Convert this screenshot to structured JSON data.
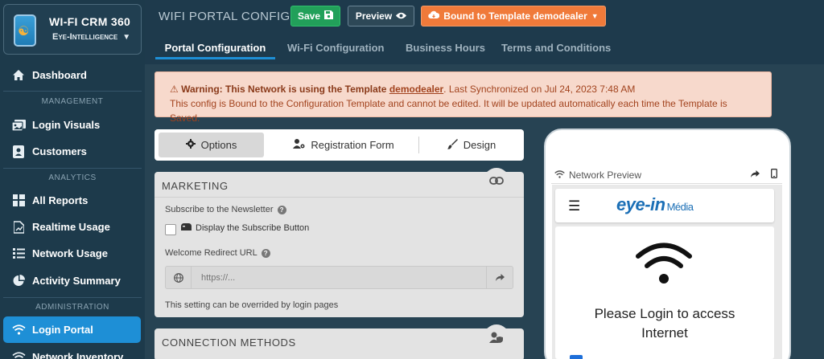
{
  "brand": {
    "title": "WI-FI CRM 360",
    "subtitle": "Eye-Intelligence",
    "caret": "▼"
  },
  "sidebar": {
    "dashboard": "Dashboard",
    "section_management": "MANAGEMENT",
    "login_visuals": "Login Visuals",
    "customers": "Customers",
    "section_analytics": "ANALYTICS",
    "all_reports": "All Reports",
    "realtime_usage": "Realtime Usage",
    "network_usage": "Network Usage",
    "activity_summary": "Activity Summary",
    "section_administration": "ADMINISTRATION",
    "login_portal": "Login Portal",
    "network_inventory": "Network Inventory"
  },
  "header": {
    "title": "WIFI PORTAL CONFIG",
    "save_label": "Save",
    "preview_label": "Preview",
    "bound_label": "Bound to Template demodealer"
  },
  "tabs": {
    "portal_configuration": "Portal Configuration",
    "wifi_configuration": "Wi-Fi Configuration",
    "business_hours": "Business Hours",
    "terms_and_conditions": "Terms and Conditions"
  },
  "warning": {
    "prefix": "Warning: This Network is using the Template",
    "template_name": "demodealer",
    "sync_text": ". Last Synchronized on Jul 24, 2023 7:48 AM",
    "line2": "This config is Bound to the Configuration Template and cannot be edited. It will be updated automatically each time the Template is Saved."
  },
  "subtabs": {
    "options": "Options",
    "registration_form": "Registration Form",
    "design": "Design"
  },
  "marketing": {
    "title": "MARKETING",
    "newsletter_label": "Subscribe to the Newsletter",
    "subscribe_checkbox_label": "Display the Subscribe Button",
    "redirect_label": "Welcome Redirect URL",
    "redirect_placeholder": "https://...",
    "note": "This setting can be overrided by login pages"
  },
  "connection": {
    "title": "CONNECTION METHODS"
  },
  "preview": {
    "label": "Network Preview",
    "logo_main": "eye-in",
    "logo_media": "Média",
    "login_line1": "Please Login to access",
    "login_line2": "Internet"
  },
  "colors": {
    "sidebar_bg": "#1d3a4b",
    "accent": "#1e8fd6",
    "save_green": "#22a05a",
    "bound_orange": "#f07a3a",
    "warning_bg": "#f7d9cc"
  }
}
